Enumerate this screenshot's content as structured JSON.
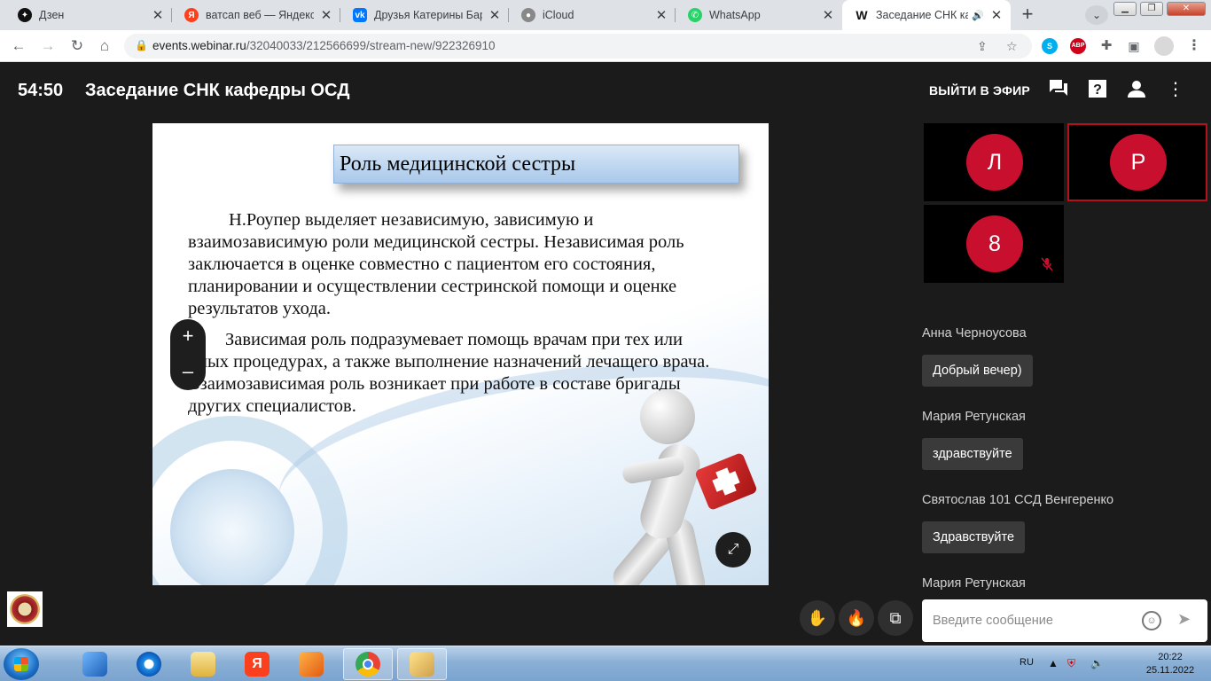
{
  "browser": {
    "tabs": [
      {
        "title": "Дзен",
        "favicon": "dzen-icon",
        "color": "#111111"
      },
      {
        "title": "ватсап веб — Яндекс: нашлось",
        "favicon": "yandex-icon",
        "color": "#fc3f1d"
      },
      {
        "title": "Друзья Катерины Барановой",
        "favicon": "vk-icon",
        "color": "#0077ff"
      },
      {
        "title": "iCloud",
        "favicon": "apple-icon",
        "color": "#888888"
      },
      {
        "title": "WhatsApp",
        "favicon": "whatsapp-icon",
        "color": "#25d366"
      },
      {
        "title": "Заседание СНК кафедры ОСД",
        "favicon": "webinar-icon",
        "color": "#111111"
      }
    ],
    "url_host": "events.webinar.ru",
    "url_path": "/32040033/212566699/stream-new/922326910"
  },
  "header": {
    "timer": "54:50",
    "title": "Заседание СНК кафедры ОСД",
    "live_button": "ВЫЙТИ В ЭФИР"
  },
  "slide": {
    "title": "Роль медицинской сестры",
    "p1": "Н.Роупер выделяет независимую, зависимую и взаимозависимую роли медицинской сестры. Независимая роль заключается в оценке совместно с пациентом его состояния, планировании и осуществлении сестринской помощи и оценке результатов ухода.",
    "p2": "Зависимая роль подразумевает помощь врачам при тех или иных процедурах, а также выполнение назначений лечащего врача. Взаимозависимая роль возникает при работе в составе бригады других специалистов."
  },
  "zoom": {
    "plus": "+",
    "minus": "–"
  },
  "participants": [
    {
      "initial": "Л",
      "speaking": false,
      "muted": false
    },
    {
      "initial": "Р",
      "speaking": true,
      "muted": false
    },
    {
      "initial": "8",
      "speaking": false,
      "muted": true
    }
  ],
  "chat": {
    "messages": [
      {
        "author": "Анна Черноусова",
        "text": "Добрый вечер)"
      },
      {
        "author": "Мария Ретунская",
        "text": "здравствуйте"
      },
      {
        "author": "Святослав 101 ССД Венгеренко",
        "text": "Здравствуйте"
      }
    ],
    "last_author": "Мария Ретунская",
    "placeholder": "Введите сообщение"
  },
  "taskbar": {
    "lang": "RU",
    "time": "20:22",
    "date": "25.11.2022"
  }
}
